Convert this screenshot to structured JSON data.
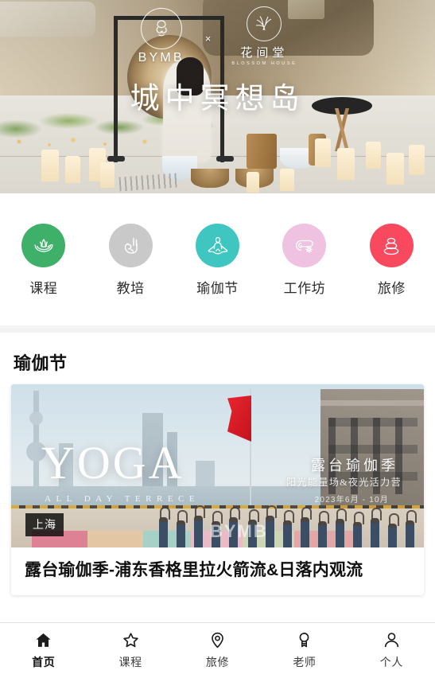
{
  "hero": {
    "title": "城中冥想岛",
    "brand_left": {
      "name": "BYMB",
      "icon": "bymb-knot-logo"
    },
    "brand_separator": "×",
    "brand_right": {
      "name_cn": "花间堂",
      "name_en": "BLOSSOM HOUSE",
      "icon": "blossom-house-logo"
    },
    "alt": "室内冥想场景：锣、蜡烛、颂钵、绿植与白色地面"
  },
  "categories": [
    {
      "label": "课程",
      "icon": "lotus-icon",
      "color": "#3fb06a"
    },
    {
      "label": "教培",
      "icon": "hand-mudra-icon",
      "color": "#c9c9c9"
    },
    {
      "label": "瑜伽节",
      "icon": "meditate-icon",
      "color": "#3fc6c0"
    },
    {
      "label": "工作坊",
      "icon": "scroll-mat-icon",
      "color": "#eec2e0"
    },
    {
      "label": "旅修",
      "icon": "stacked-stones-icon",
      "color": "#f9495e"
    }
  ],
  "section": {
    "title": "瑜伽节"
  },
  "card": {
    "city_badge": "上海",
    "title": "露台瑜伽季-浦东香格里拉火箭流&日落内观流",
    "poster": {
      "headline": "YOGA",
      "subhead": "ALL DAY TERRECE",
      "cn_line1": "露台瑜伽季",
      "cn_line2": "阳光能量场&夜光活力营",
      "cn_line3": "2023年6月 - 10月",
      "watermark": "BYMB"
    }
  },
  "tabbar": {
    "items": [
      {
        "label": "首页",
        "icon": "home-icon",
        "active": true
      },
      {
        "label": "课程",
        "icon": "star-icon",
        "active": false
      },
      {
        "label": "旅修",
        "icon": "pin-icon",
        "active": false
      },
      {
        "label": "老师",
        "icon": "medal-icon",
        "active": false
      },
      {
        "label": "个人",
        "icon": "person-icon",
        "active": false
      }
    ]
  },
  "theme": {
    "bg": "#ffffff",
    "divider": "#f4f4f4",
    "text_primary": "#111111",
    "tabbar_border": "#e3e3e3"
  }
}
